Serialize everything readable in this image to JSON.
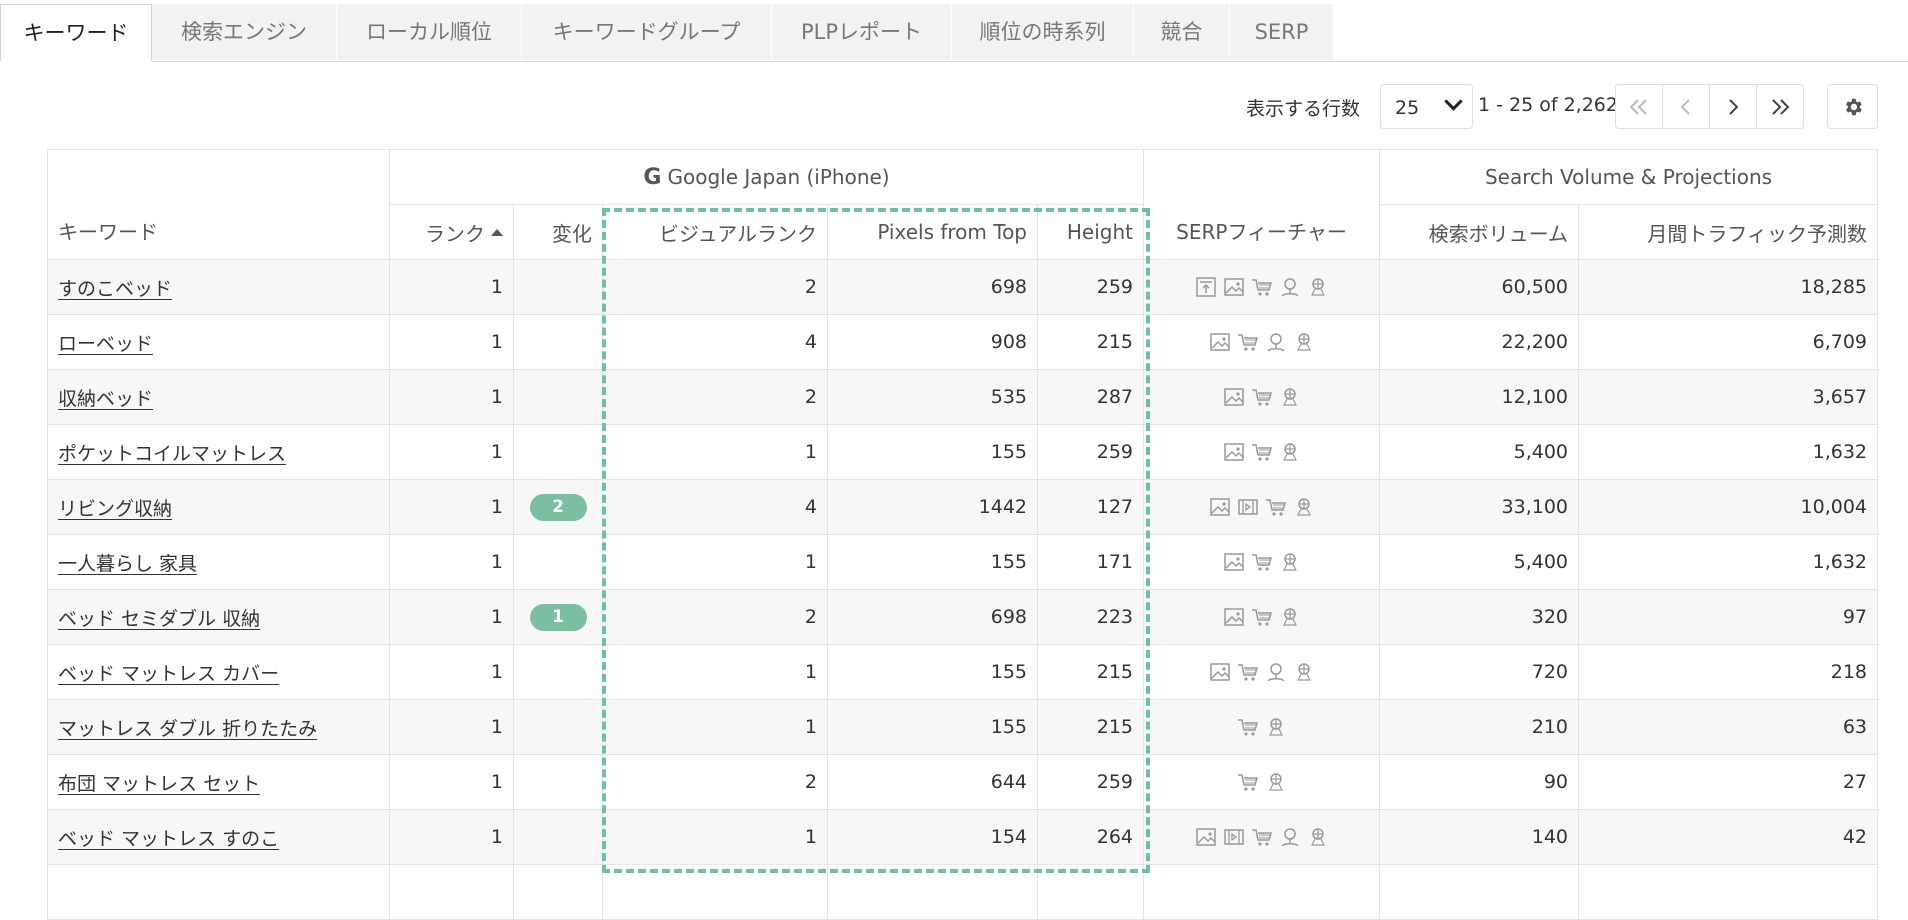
{
  "tabs": [
    "キーワード",
    "検索エンジン",
    "ローカル順位",
    "キーワードグループ",
    "PLPレポート",
    "順位の時系列",
    "競合",
    "SERP"
  ],
  "toolbar": {
    "rows_label": "表示する行数",
    "rows_value": "25",
    "range": "1 - 25 of 2,262"
  },
  "header": {
    "group_google": "Google Japan (iPhone)",
    "group_volume": "Search Volume & Projections",
    "col_keyword": "キーワード",
    "col_rank": "ランク",
    "col_change": "変化",
    "col_visual_rank": "ビジュアルランク",
    "col_pixels": "Pixels from Top",
    "col_height": "Height",
    "col_serp": "SERPフィーチャー",
    "col_volume": "検索ボリューム",
    "col_traffic": "月間トラフィック予測数"
  },
  "rows": [
    {
      "keyword": "すのこベッド",
      "rank": "1",
      "change": "",
      "visual": "2",
      "pixels": "698",
      "height": "259",
      "features": [
        "featured-snippet",
        "image",
        "shopping",
        "local",
        "knowledge"
      ],
      "volume": "60,500",
      "traffic": "18,285"
    },
    {
      "keyword": "ローベッド",
      "rank": "1",
      "change": "",
      "visual": "4",
      "pixels": "908",
      "height": "215",
      "features": [
        "image",
        "shopping",
        "local",
        "knowledge"
      ],
      "volume": "22,200",
      "traffic": "6,709"
    },
    {
      "keyword": "収納ベッド",
      "rank": "1",
      "change": "",
      "visual": "2",
      "pixels": "535",
      "height": "287",
      "features": [
        "image",
        "shopping",
        "knowledge"
      ],
      "volume": "12,100",
      "traffic": "3,657"
    },
    {
      "keyword": "ポケットコイルマットレス",
      "rank": "1",
      "change": "",
      "visual": "1",
      "pixels": "155",
      "height": "259",
      "features": [
        "image",
        "shopping",
        "knowledge"
      ],
      "volume": "5,400",
      "traffic": "1,632"
    },
    {
      "keyword": "リビング収納",
      "rank": "1",
      "change": "2",
      "visual": "4",
      "pixels": "1442",
      "height": "127",
      "features": [
        "image",
        "video",
        "shopping",
        "knowledge"
      ],
      "volume": "33,100",
      "traffic": "10,004"
    },
    {
      "keyword": "一人暮らし 家具",
      "rank": "1",
      "change": "",
      "visual": "1",
      "pixels": "155",
      "height": "171",
      "features": [
        "image",
        "shopping",
        "knowledge"
      ],
      "volume": "5,400",
      "traffic": "1,632"
    },
    {
      "keyword": "ベッド セミダブル 収納",
      "rank": "1",
      "change": "1",
      "visual": "2",
      "pixels": "698",
      "height": "223",
      "features": [
        "image",
        "shopping",
        "knowledge"
      ],
      "volume": "320",
      "traffic": "97"
    },
    {
      "keyword": "ベッド マットレス カバー",
      "rank": "1",
      "change": "",
      "visual": "1",
      "pixels": "155",
      "height": "215",
      "features": [
        "image",
        "shopping",
        "local",
        "knowledge"
      ],
      "volume": "720",
      "traffic": "218"
    },
    {
      "keyword": "マットレス ダブル 折りたたみ",
      "rank": "1",
      "change": "",
      "visual": "1",
      "pixels": "155",
      "height": "215",
      "features": [
        "shopping",
        "knowledge"
      ],
      "volume": "210",
      "traffic": "63"
    },
    {
      "keyword": "布団 マットレス セット",
      "rank": "1",
      "change": "",
      "visual": "2",
      "pixels": "644",
      "height": "259",
      "features": [
        "shopping",
        "knowledge"
      ],
      "volume": "90",
      "traffic": "27"
    },
    {
      "keyword": "ベッド マットレス すのこ",
      "rank": "1",
      "change": "",
      "visual": "1",
      "pixels": "154",
      "height": "264",
      "features": [
        "image",
        "video",
        "shopping",
        "local",
        "knowledge"
      ],
      "volume": "140",
      "traffic": "42"
    }
  ],
  "colors": {
    "badge": "#7bbfa3",
    "highlight": "#6bc2a1"
  }
}
